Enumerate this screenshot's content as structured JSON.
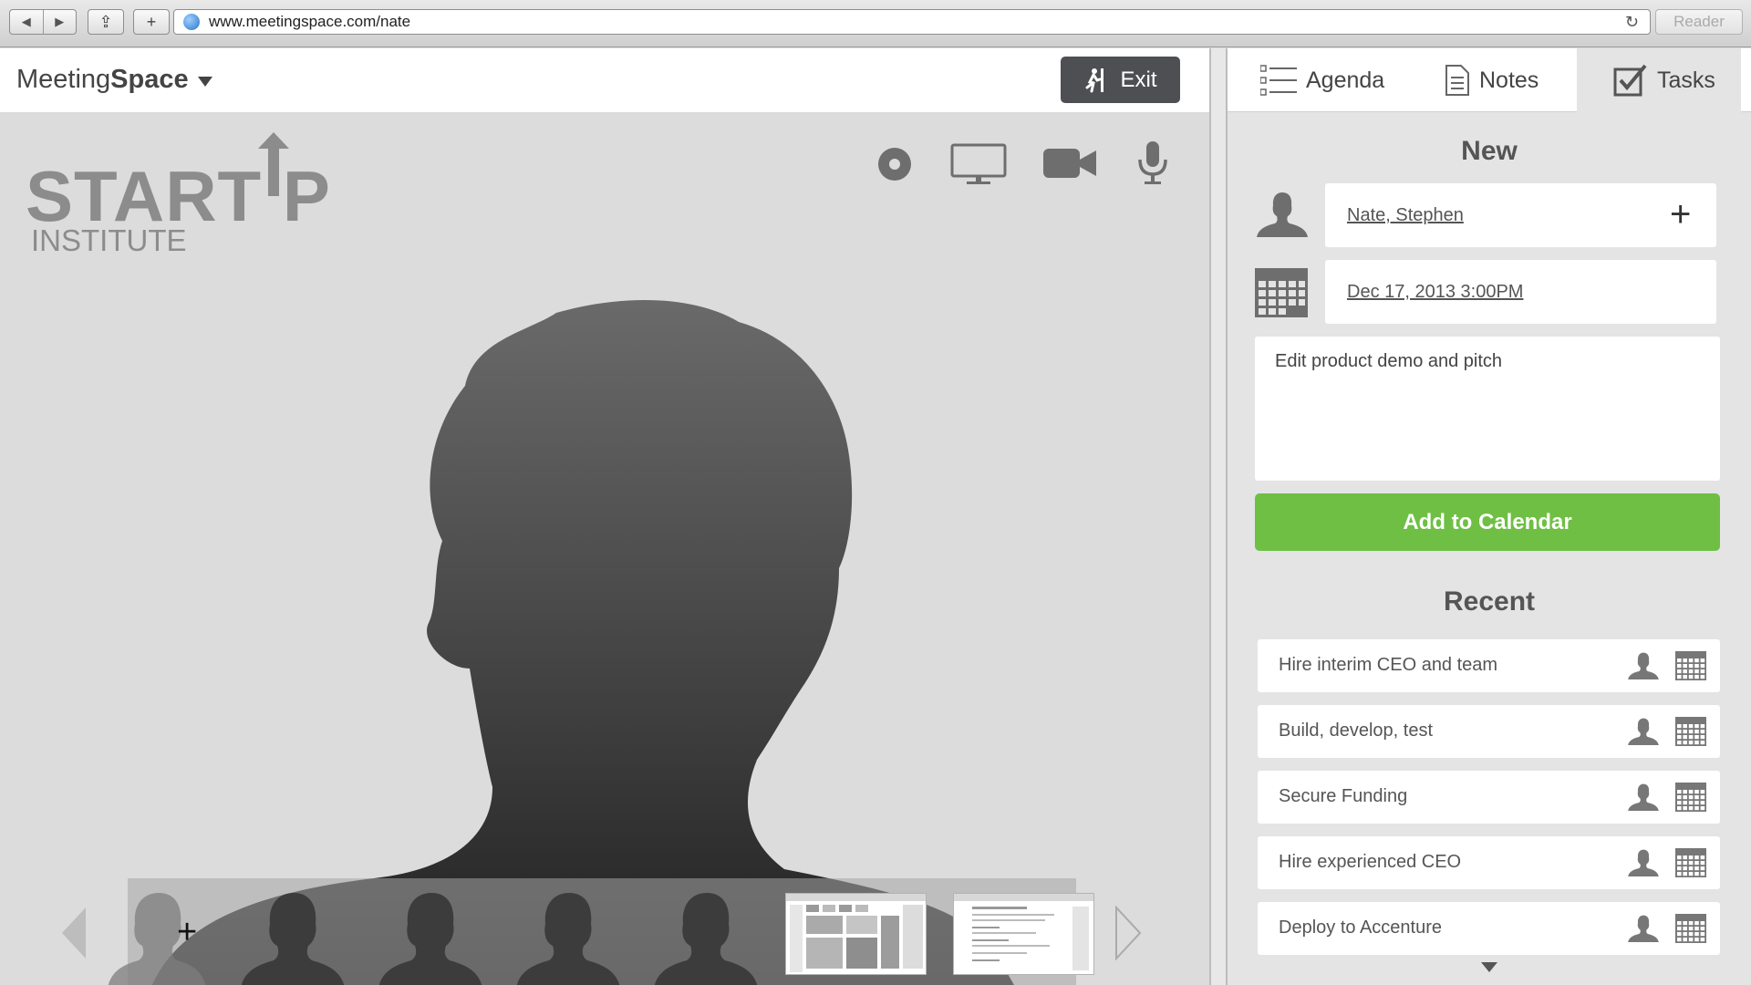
{
  "browser": {
    "url": "www.meetingspace.com/nate",
    "reader_label": "Reader",
    "back_glyph": "◀",
    "forward_glyph": "▶",
    "share_glyph": "⇪",
    "new_tab_glyph": "+",
    "reload_glyph": "↻"
  },
  "app": {
    "logo_light": "Meeting",
    "logo_bold": "Space",
    "exit_label": "Exit"
  },
  "stage": {
    "brand_word": "START P",
    "brand_sub": "INSTITUTE",
    "media_controls": [
      "record-icon",
      "screen-share-icon",
      "video-camera-icon",
      "microphone-icon"
    ],
    "add_participant_glyph": "+"
  },
  "side": {
    "tabs": [
      {
        "label": "Agenda",
        "icon": "list-icon"
      },
      {
        "label": "Notes",
        "icon": "document-icon"
      },
      {
        "label": "Tasks",
        "icon": "checkbox-icon",
        "active": true
      }
    ],
    "new_title": "New",
    "assignees": "Nate, Stephen",
    "add_glyph": "+",
    "due": "Dec 17, 2013  3:00PM",
    "task_text": "Edit product demo and pitch",
    "add_calendar_label": "Add to Calendar",
    "recent_title": "Recent",
    "recent": [
      "Hire interim CEO and team",
      "Build, develop, test",
      "Secure Funding",
      "Hire experienced CEO",
      "Deploy to Accenture"
    ]
  },
  "colors": {
    "accent_green": "#6fbf44",
    "exit_bg": "#4d4f53"
  }
}
